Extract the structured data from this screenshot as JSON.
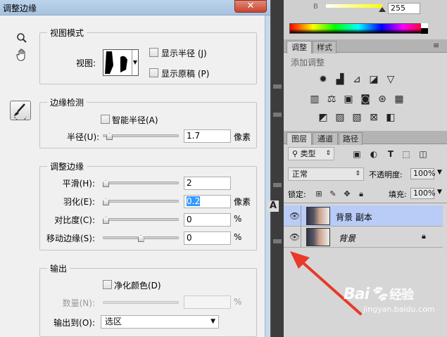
{
  "dialog": {
    "title": "调整边缘",
    "close_label": "✕",
    "view_mode": {
      "legend": "视图模式",
      "view_label": "视图:",
      "show_radius": "显示半径 (J)",
      "show_original": "显示原稿 (P)"
    },
    "edge_detection": {
      "legend": "边缘检测",
      "smart_radius": "智能半径(A)",
      "radius_label": "半径(U):",
      "radius_value": "1.7",
      "radius_unit": "像素",
      "radius_level": 0.05
    },
    "adjust_edge": {
      "legend": "调整边缘",
      "rows": [
        {
          "label": "平滑(H):",
          "value": "2",
          "unit": "",
          "level": 0.0
        },
        {
          "label": "羽化(E):",
          "value": "0.2",
          "unit": "像素",
          "level": 0.0
        },
        {
          "label": "对比度(C):",
          "value": "0",
          "unit": "%",
          "level": 0.0
        },
        {
          "label": "移动边缘(S):",
          "value": "0",
          "unit": "%",
          "level": 0.5
        }
      ]
    },
    "output": {
      "legend": "输出",
      "decontaminate": "净化颜色(D)",
      "amount_label": "数量(N):",
      "amount_unit": "%",
      "output_to_label": "输出到(O):",
      "output_to_value": "选区"
    }
  },
  "color_panel": {
    "channel_label": "B",
    "channel_value": "255",
    "channel_level": 1.0
  },
  "adjust_panel": {
    "tabs": [
      "调整",
      "样式"
    ],
    "hint": "添加调整"
  },
  "layers_panel": {
    "tabs": [
      "图层",
      "通道",
      "路径"
    ],
    "filter_label": "类型",
    "blend_mode": "正常",
    "opacity_label": "不透明度:",
    "opacity_value": "100%",
    "lock_label": "锁定:",
    "fill_label": "填充:",
    "fill_value": "100%",
    "layers": [
      {
        "name": "背景 副本",
        "selected": true
      },
      {
        "name": "背景",
        "selected": false,
        "locked": true
      }
    ]
  },
  "watermark": {
    "brand": "Bai",
    "brand_tail": "经验",
    "url": "jingyan.baidu.com"
  },
  "colors": {
    "accent_red": "#e8392b",
    "selection_blue": "#3399ff",
    "layer_selected": "#b9ccf7"
  }
}
